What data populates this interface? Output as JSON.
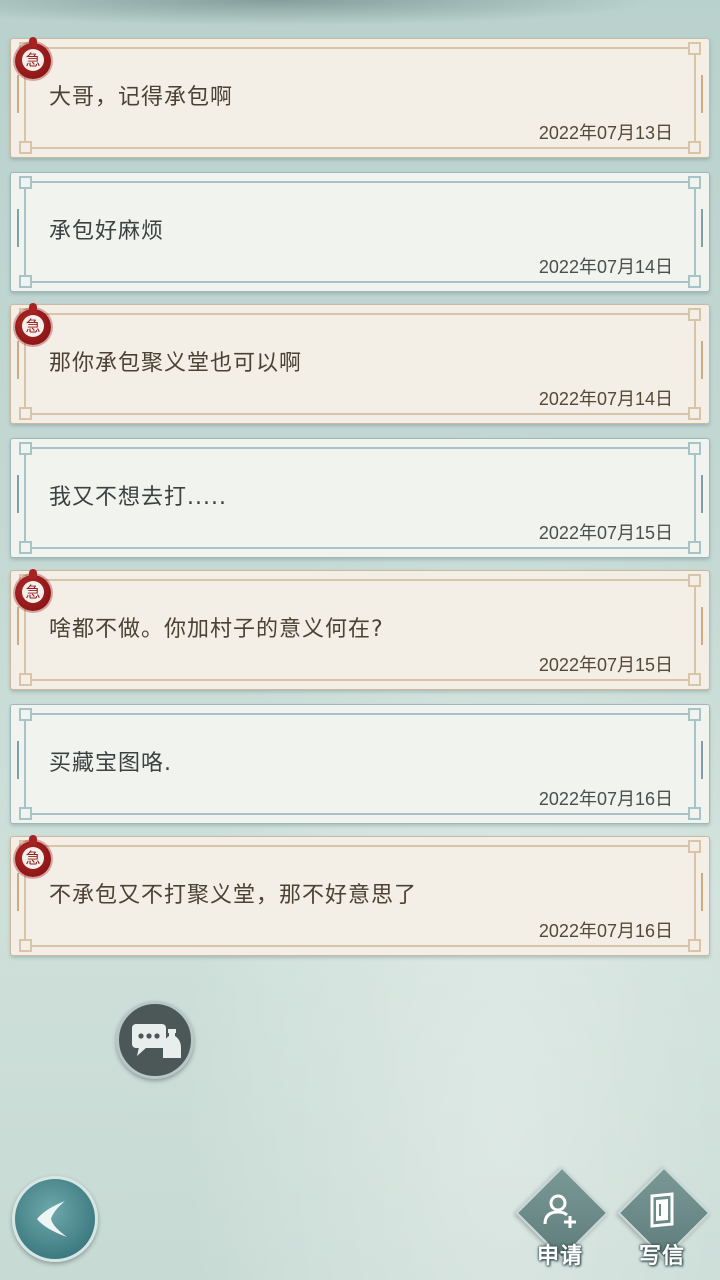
{
  "messages": [
    {
      "text": "大哥，记得承包啊",
      "date": "2022年07月13日",
      "sender": "friend",
      "seal_char": "急"
    },
    {
      "text": "承包好麻烦",
      "date": "2022年07月14日",
      "sender": "me"
    },
    {
      "text": "那你承包聚义堂也可以啊",
      "date": "2022年07月14日",
      "sender": "friend",
      "seal_char": "急"
    },
    {
      "text": "我又不想去打.....",
      "date": "2022年07月15日",
      "sender": "me"
    },
    {
      "text": "啥都不做。你加村子的意义何在?",
      "date": "2022年07月15日",
      "sender": "friend",
      "seal_char": "急"
    },
    {
      "text": "买藏宝图咯.",
      "date": "2022年07月16日",
      "sender": "me"
    },
    {
      "text": "不承包又不打聚义堂，那不好意思了",
      "date": "2022年07月16日",
      "sender": "friend",
      "seal_char": "急"
    }
  ],
  "buttons": {
    "apply_label": "申请",
    "write_label": "写信"
  },
  "icons": {
    "back": "back-arrow-icon",
    "chat": "chat-bubble-icon",
    "apply": "add-user-icon",
    "write": "letter-icon",
    "seal": "urgent-seal-icon"
  },
  "colors": {
    "friend_card_bg": "#f0f3ee",
    "my_card_bg": "#f3efe7",
    "seal_red": "#a62323",
    "background": "#c4d8d3"
  }
}
